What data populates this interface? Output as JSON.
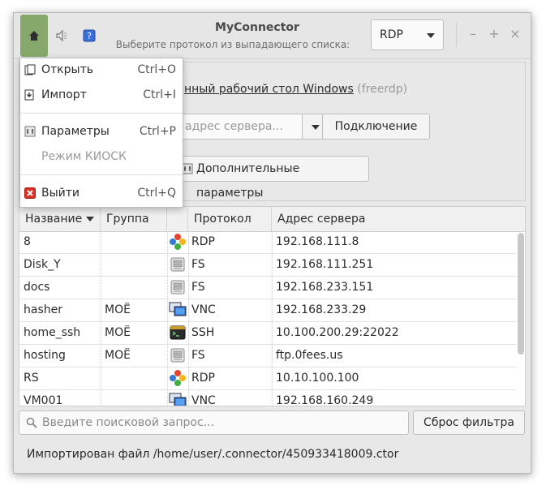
{
  "window": {
    "title": "MyConnector",
    "subtitle": "Выберите протокол из выпадающего списка:",
    "protocol_selected": "RDP",
    "controls": {
      "minimize": "–",
      "maximize": "+",
      "close": "×"
    }
  },
  "header_icons": [
    "home-icon",
    "speaker-icon",
    "help-icon"
  ],
  "menu": {
    "items": [
      {
        "label": "Открыть",
        "shortcut": "Ctrl+O",
        "icon": "open-icon"
      },
      {
        "label": "Импорт",
        "shortcut": "Ctrl+I",
        "icon": "import-icon"
      },
      {
        "label": "Параметры",
        "shortcut": "Ctrl+P",
        "icon": "settings-icon"
      },
      {
        "label": "Режим КИОСК",
        "shortcut": "",
        "icon": ""
      },
      {
        "label": "Выйти",
        "shortcut": "Ctrl+Q",
        "icon": "exit-icon"
      }
    ]
  },
  "rdp_panel": {
    "desc_partial": "нный рабочий стол Windows",
    "desc_suffix": "(freerdp)",
    "server_placeholder": "адрес сервера...",
    "connect_label": "Подключение",
    "advanced_label": "Дополнительные параметры"
  },
  "table": {
    "headers": {
      "name": "Название",
      "group": "Группа",
      "protocol": "Протокол",
      "address": "Адрес сервера"
    },
    "rows": [
      {
        "name": "8",
        "group": "",
        "icon": "rdp",
        "protocol": "RDP",
        "address": "192.168.111.8"
      },
      {
        "name": "Disk_Y",
        "group": "",
        "icon": "fs",
        "protocol": "FS",
        "address": "192.168.111.251"
      },
      {
        "name": "docs",
        "group": "",
        "icon": "fs",
        "protocol": "FS",
        "address": "192.168.233.151"
      },
      {
        "name": "hasher",
        "group": "МОЁ",
        "icon": "vnc",
        "protocol": "VNC",
        "address": "192.168.233.29"
      },
      {
        "name": "home_ssh",
        "group": "МОЁ",
        "icon": "ssh",
        "protocol": "SSH",
        "address": "10.100.200.29:22022"
      },
      {
        "name": "hosting",
        "group": "МОЁ",
        "icon": "fs",
        "protocol": "FS",
        "address": "ftp.0fees.us"
      },
      {
        "name": "RS",
        "group": "",
        "icon": "rdp",
        "protocol": "RDP",
        "address": "10.10.100.100"
      },
      {
        "name": "VM001",
        "group": "",
        "icon": "vnc",
        "protocol": "VNC",
        "address": "192.168.160.249"
      }
    ]
  },
  "search": {
    "placeholder": "Введите поисковой запрос..."
  },
  "reset_label": "Сброс фильтра",
  "status": "Импортирован файл /home/user/.connector/450933418009.ctor"
}
